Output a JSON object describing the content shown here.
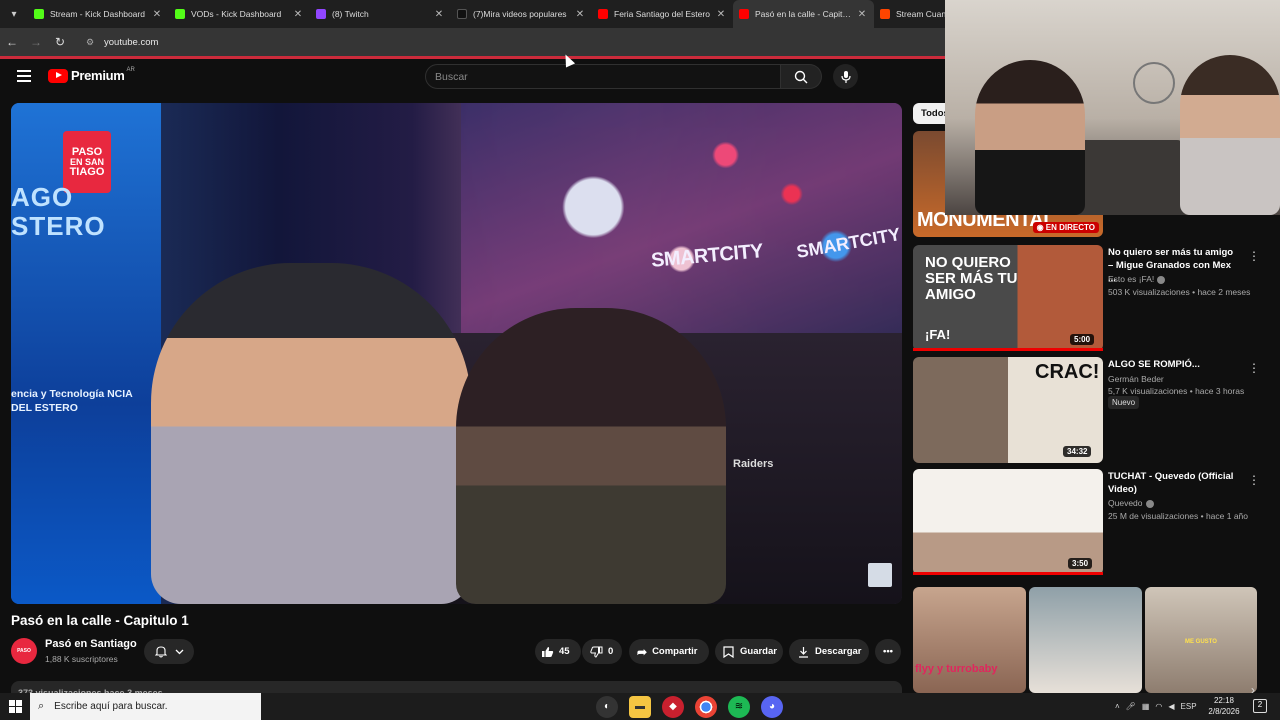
{
  "browser": {
    "tabs": [
      {
        "label": "Stream - Kick Dashboard",
        "color": "#53fc18",
        "active": false
      },
      {
        "label": "VODs - Kick Dashboard",
        "color": "#53fc18",
        "active": false
      },
      {
        "label": "(8) Twitch",
        "color": "#9146ff",
        "active": false
      },
      {
        "label": "(7)Mira videos populares",
        "color": "#111111",
        "active": false
      },
      {
        "label": "Feria Santiago del Estero",
        "color": "#ff0000",
        "active": false
      },
      {
        "label": "Pasó en la calle - Capitulo",
        "color": "#ff0000",
        "active": true
      },
      {
        "label": "Stream Cuando",
        "color": "#ff4500",
        "active": false
      }
    ],
    "url": "youtube.com"
  },
  "masthead": {
    "logo_word": "Premium",
    "country": "AR",
    "search_placeholder": "Buscar"
  },
  "video_frame": {
    "banner_logo_line1": "PASO",
    "banner_logo_line2": "EN SAN",
    "banner_logo_line3": "TIAGO",
    "banner_text_top": "AGO\nSTERO",
    "banner_text_bottom": "encia y Tecnología NCIA DEL ESTERO",
    "sign1": "SMARTCITY",
    "sign2": "SMARTCITY",
    "bag_text": "Raiders"
  },
  "video": {
    "title": "Pasó en la calle - Capitulo 1",
    "channel": "Pasó en Santiago",
    "subscribers": "1,88 K suscriptores",
    "likes": "45",
    "dislikes": "0",
    "share": "Compartir",
    "save": "Guardar",
    "download": "Descargar",
    "views_partial": "373 visualizaciones  hace 3 meses"
  },
  "sidebar": {
    "chip": "Todos",
    "live": {
      "thumb_text": "MONUMENTAL",
      "badge": "EN DIRECTO"
    },
    "items": [
      {
        "title": "No quiero ser más tu amigo – Migue Granados con Mex ...",
        "channel": "Esto es ¡FA!",
        "meta": "503 K visualizaciones • hace 2 meses",
        "duration": "5:00",
        "thumb_text": "NO QUIERO SER MÁS TU AMIGO",
        "thumb_sub": "¡FA!"
      },
      {
        "title": "ALGO SE ROMPIÓ...",
        "channel": "Germán Beder",
        "meta": "5,7 K visualizaciones • hace 3 horas",
        "badge": "Nuevo",
        "duration": "34:32",
        "thumb_text": "CRAC!"
      },
      {
        "title": "TUCHAT - Quevedo (Official Video)",
        "channel": "Quevedo",
        "meta": "25 M de visualizaciones • hace 1 año",
        "duration": "3:50"
      }
    ],
    "shorts": [
      {
        "overlay": "flyy y turrobaby"
      },
      {
        "overlay": ""
      },
      {
        "overlay": "ME GUSTO"
      }
    ]
  },
  "taskbar": {
    "search": "Escribe aquí para buscar.",
    "lang": "ESP",
    "time": "22:18",
    "date": "2/8/2026",
    "notifications": "2"
  }
}
